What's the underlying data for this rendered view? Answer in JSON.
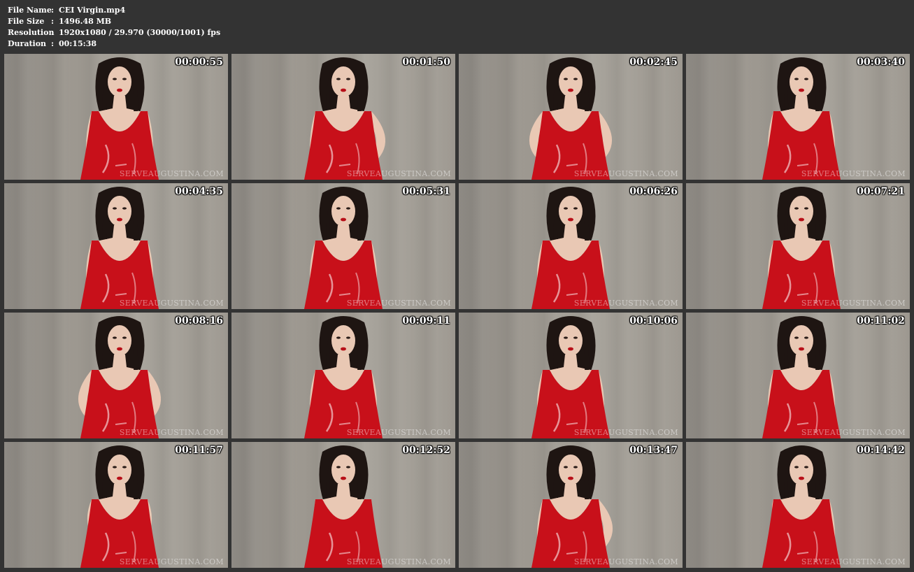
{
  "header": {
    "file_name_label": "File Name",
    "file_name": "CEI Virgin.mp4",
    "file_size_label": "File Size",
    "file_size": "1496.48 MB",
    "resolution_label": "Resolution",
    "resolution": "1920x1080 / 29.970 (30000/1001) fps",
    "duration_label": "Duration",
    "duration": "00:15:38",
    "separator": ":"
  },
  "watermark": "SERVEAUGUSTINA.COM",
  "colors": {
    "background": "#333333",
    "dress": "#c8101a",
    "hair": "#1e1512",
    "skin": "#e9c8b4"
  },
  "thumbnails": [
    {
      "time": "00:00:55",
      "pose": "arms-down"
    },
    {
      "time": "00:01:50",
      "pose": "hand-hip-right"
    },
    {
      "time": "00:02:45",
      "pose": "hands-hips"
    },
    {
      "time": "00:03:40",
      "pose": "arms-down"
    },
    {
      "time": "00:04:35",
      "pose": "arms-down"
    },
    {
      "time": "00:05:31",
      "pose": "arms-down"
    },
    {
      "time": "00:06:26",
      "pose": "arms-down"
    },
    {
      "time": "00:07:21",
      "pose": "arms-down"
    },
    {
      "time": "00:08:16",
      "pose": "hands-hips"
    },
    {
      "time": "00:09:11",
      "pose": "arms-down"
    },
    {
      "time": "00:10:06",
      "pose": "arms-down"
    },
    {
      "time": "00:11:02",
      "pose": "arms-down"
    },
    {
      "time": "00:11:57",
      "pose": "hands-front"
    },
    {
      "time": "00:12:52",
      "pose": "leaning"
    },
    {
      "time": "00:13:47",
      "pose": "hand-hip-right"
    },
    {
      "time": "00:14:42",
      "pose": "hand-chest"
    }
  ]
}
